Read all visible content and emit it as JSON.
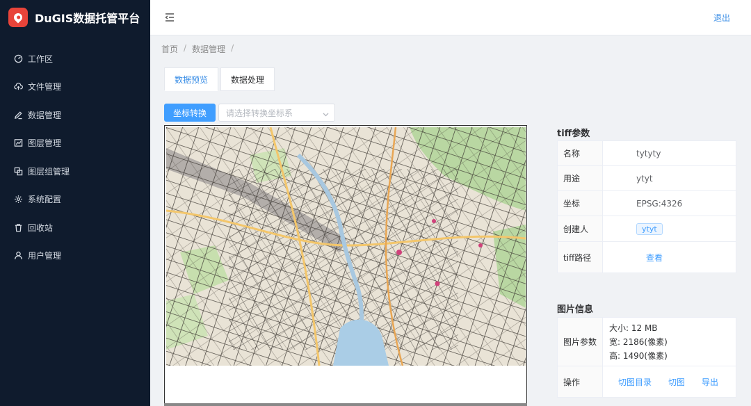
{
  "app": {
    "title": "DuGIS数据托管平台",
    "brand_color": "#e8443a"
  },
  "sidebar": {
    "items": [
      {
        "label": "工作区",
        "icon": "dashboard-icon"
      },
      {
        "label": "文件管理",
        "icon": "cloud-upload-icon"
      },
      {
        "label": "数据管理",
        "icon": "edit-icon"
      },
      {
        "label": "图层管理",
        "icon": "chart-icon"
      },
      {
        "label": "图层组管理",
        "icon": "copy-icon"
      },
      {
        "label": "系统配置",
        "icon": "gear-icon"
      },
      {
        "label": "回收站",
        "icon": "trash-icon"
      },
      {
        "label": "用户管理",
        "icon": "user-icon"
      }
    ]
  },
  "header": {
    "logout_label": "退出"
  },
  "breadcrumb": {
    "items": [
      "首页",
      "数据管理"
    ]
  },
  "tabs": [
    {
      "label": "数据预览",
      "active": true
    },
    {
      "label": "数据处理",
      "active": false
    }
  ],
  "toolbar": {
    "convert_label": "坐标转换",
    "crs_placeholder": "请选择转换坐标系"
  },
  "tiff_params": {
    "title": "tiff参数",
    "rows": [
      {
        "key": "名称",
        "value": "tytyty"
      },
      {
        "key": "用途",
        "value": "ytyt"
      },
      {
        "key": "坐标",
        "value": "EPSG:4326"
      },
      {
        "key": "创建人",
        "value": "ytyt"
      },
      {
        "key": "tiff路径",
        "value": "查看"
      }
    ]
  },
  "image_info": {
    "title": "图片信息",
    "params_key": "图片参数",
    "size": "大小: 12 MB",
    "width": "宽: 2186(像素)",
    "height": "高: 1490(像素)",
    "ops_key": "操作",
    "ops": [
      "切图目录",
      "切图",
      "导出"
    ]
  },
  "colors": {
    "accent": "#409eff",
    "sidebar_bg": "#0f1b2d"
  }
}
